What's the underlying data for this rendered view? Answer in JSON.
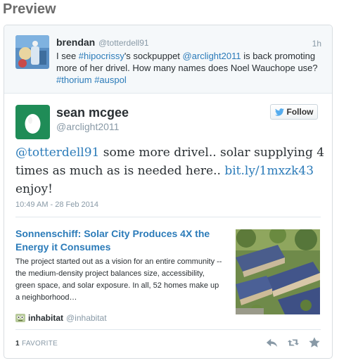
{
  "preview": {
    "title": "Preview"
  },
  "parent_tweet": {
    "name": "brendan",
    "handle": "@totterdell91",
    "time": "1h",
    "text_parts": {
      "p1": "I see ",
      "hashtag1": "#hipocrissy",
      "p2": "'s sockpuppet ",
      "mention": "@arclight2011",
      "p3": " is back promoting more of her drivel. How many names does Noel Wauchope use? ",
      "hashtag2": "#thorium",
      "space": " ",
      "hashtag3": "#auspol"
    }
  },
  "tweet": {
    "name": "sean mcgee",
    "handle": "@arclight2011",
    "follow_label": "Follow",
    "text_parts": {
      "mention": "@totterdell91",
      "p1": " some more drivel.. solar supplying 4 times as much as is needed here.. ",
      "link": "bit.ly/1mxzk43",
      "p2": " enjoy!"
    },
    "date": "10:49 AM - 28 Feb 2014"
  },
  "link_card": {
    "title": "Sonnenschiff: Solar City Produces 4X the Energy it Consumes",
    "description": "The project started out as a vision for an entire community -- the medium-density project balances size, accessibility, green space, and solar exposure. In all, 52 homes make up a neighborhood…",
    "source_name": "inhabitat",
    "source_handle": "@inhabitat"
  },
  "footer": {
    "favorite_count": "1",
    "favorite_label": "FAVORITE"
  },
  "colors": {
    "link": "#2b7bb9",
    "muted": "#8899a6",
    "egg_background": "#1f8c57",
    "twitter_blue": "#55acee"
  }
}
